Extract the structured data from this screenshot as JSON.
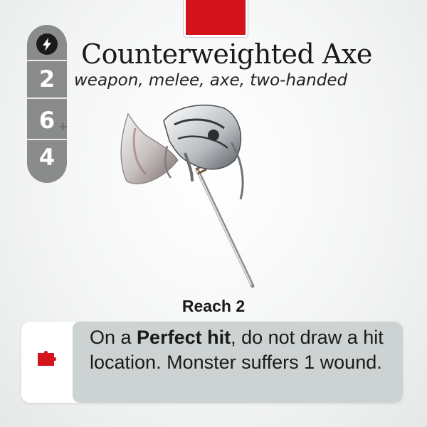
{
  "card": {
    "title": "Counterweighted Axe",
    "keywords": "weapon, melee, axe, two-handed",
    "accent_color": "#d3141c",
    "stats": {
      "speed_icon": "lightning-bolt-icon",
      "speed": "2",
      "accuracy": "6",
      "accuracy_suffix": "+",
      "strength": "4"
    },
    "reach": "Reach 2",
    "ability": {
      "icon": "puzzle-piece-icon",
      "prefix": "On a ",
      "emphasis": "Perfect hit",
      "suffix": ", do not draw a hit location. Monster suffers 1 wound."
    },
    "art": "axe-illustration"
  }
}
